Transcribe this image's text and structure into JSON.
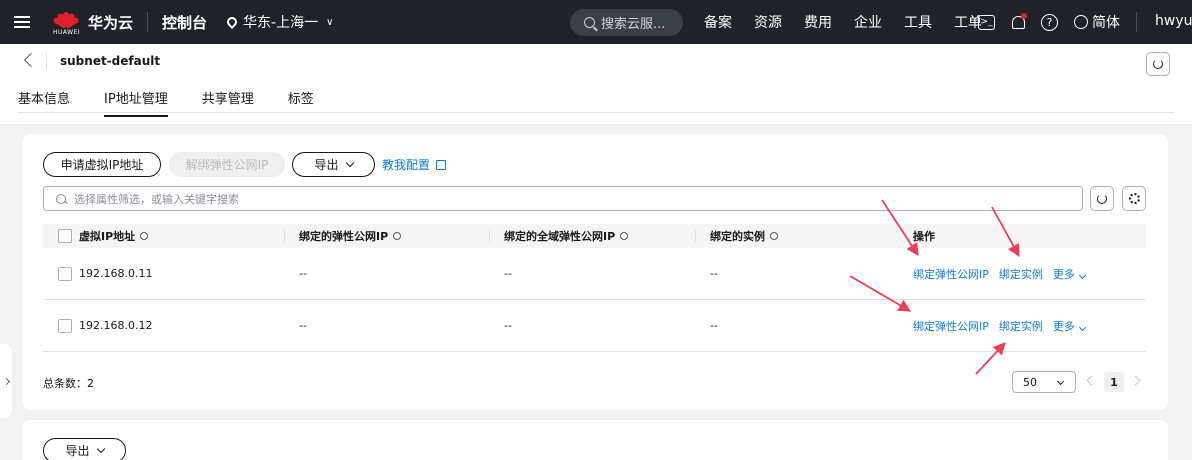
{
  "topbar": {
    "brand": "华为云",
    "logo_text": "HUAWEI",
    "console": "控制台",
    "region": "华东-上海一",
    "search_placeholder": "搜索云服...",
    "nav": [
      "备案",
      "资源",
      "费用",
      "企业",
      "工具",
      "工单"
    ],
    "language": "简体",
    "user": "hwyun"
  },
  "header": {
    "title": "subnet-default",
    "tabs": [
      "基本信息",
      "IP地址管理",
      "共享管理",
      "标签"
    ],
    "active_tab": "IP地址管理"
  },
  "toolbar": {
    "apply_vip": "申请虚拟IP地址",
    "unbind_eip": "解绑弹性公网IP",
    "export": "导出",
    "guide": "教我配置",
    "search_placeholder": "选择属性筛选，或输入关键字搜索"
  },
  "table": {
    "columns": [
      "虚拟IP地址",
      "绑定的弹性公网IP",
      "绑定的全域弹性公网IP",
      "绑定的实例",
      "操作"
    ],
    "rows": [
      {
        "ip": "192.168.0.11",
        "eip": "--",
        "global_eip": "--",
        "instance": "--"
      },
      {
        "ip": "192.168.0.12",
        "eip": "--",
        "global_eip": "--",
        "instance": "--"
      }
    ],
    "actions": {
      "bind_eip": "绑定弹性公网IP",
      "bind_instance": "绑定实例",
      "more": "更多"
    }
  },
  "footer": {
    "total": "总条数：2",
    "page_size": "50",
    "page": "1"
  },
  "second_card": {
    "export": "导出"
  },
  "colors": {
    "topbar_bg": "#1f2329",
    "link_blue": "#0e7bd5",
    "huawei_red": "#e0202b",
    "annotation_arrow": "#e8405a"
  }
}
